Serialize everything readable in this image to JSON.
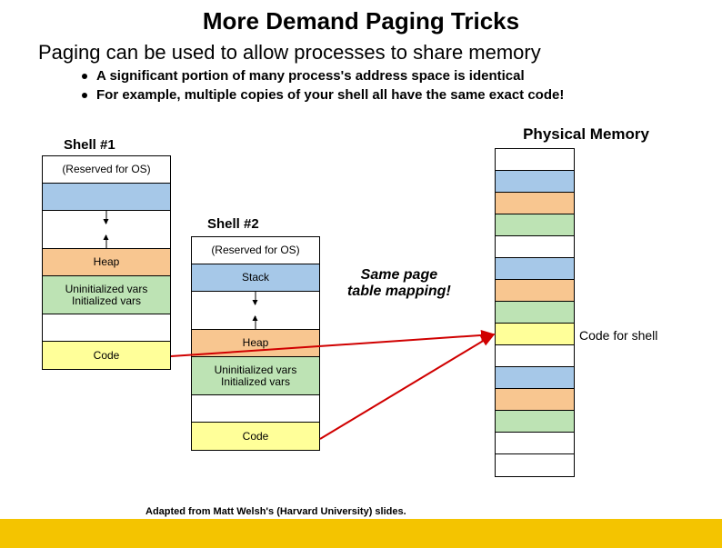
{
  "title": "More Demand Paging Tricks",
  "subtitle": "Paging can be used to allow processes to share memory",
  "bullets": [
    "A significant portion of many process's address space is identical",
    "For example, multiple copies of your shell all have the same exact code!"
  ],
  "labels": {
    "shell1": "Shell #1",
    "shell2": "Shell #2",
    "phys": "Physical Memory",
    "same": "Same page\ntable mapping!",
    "codeForShell": "Code for shell"
  },
  "shell1": {
    "cells": [
      {
        "text": "(Reserved for OS)",
        "cls": "c-white"
      },
      {
        "text": "",
        "cls": "c-blue"
      },
      {
        "text": "",
        "cls": "c-white",
        "gap": true
      },
      {
        "text": "Heap",
        "cls": "c-orange"
      },
      {
        "text": "Uninitialized vars",
        "cls": "c-green",
        "sub": "Initialized vars",
        "tall": true
      },
      {
        "text": "",
        "cls": "c-white"
      },
      {
        "text": "Code",
        "cls": "c-yellow"
      }
    ]
  },
  "shell2": {
    "cells": [
      {
        "text": "(Reserved for OS)",
        "cls": "c-white"
      },
      {
        "text": "Stack",
        "cls": "c-blue"
      },
      {
        "text": "",
        "cls": "c-white",
        "gap": true
      },
      {
        "text": "Heap",
        "cls": "c-orange"
      },
      {
        "text": "Uninitialized vars",
        "cls": "c-green",
        "sub": "Initialized vars",
        "tall": true
      },
      {
        "text": "",
        "cls": "c-white"
      },
      {
        "text": "Code",
        "cls": "c-yellow"
      }
    ]
  },
  "phys": {
    "cells": [
      {
        "cls": "c-white"
      },
      {
        "cls": "c-blue"
      },
      {
        "cls": "c-orange"
      },
      {
        "cls": "c-green"
      },
      {
        "cls": "c-white"
      },
      {
        "cls": "c-blue"
      },
      {
        "cls": "c-orange"
      },
      {
        "cls": "c-green"
      },
      {
        "cls": "c-yellow"
      },
      {
        "cls": "c-white"
      },
      {
        "cls": "c-blue"
      },
      {
        "cls": "c-orange"
      },
      {
        "cls": "c-green"
      },
      {
        "cls": "c-white"
      },
      {
        "cls": "c-white"
      }
    ]
  },
  "footer": "Adapted from Matt Welsh's (Harvard University) slides."
}
